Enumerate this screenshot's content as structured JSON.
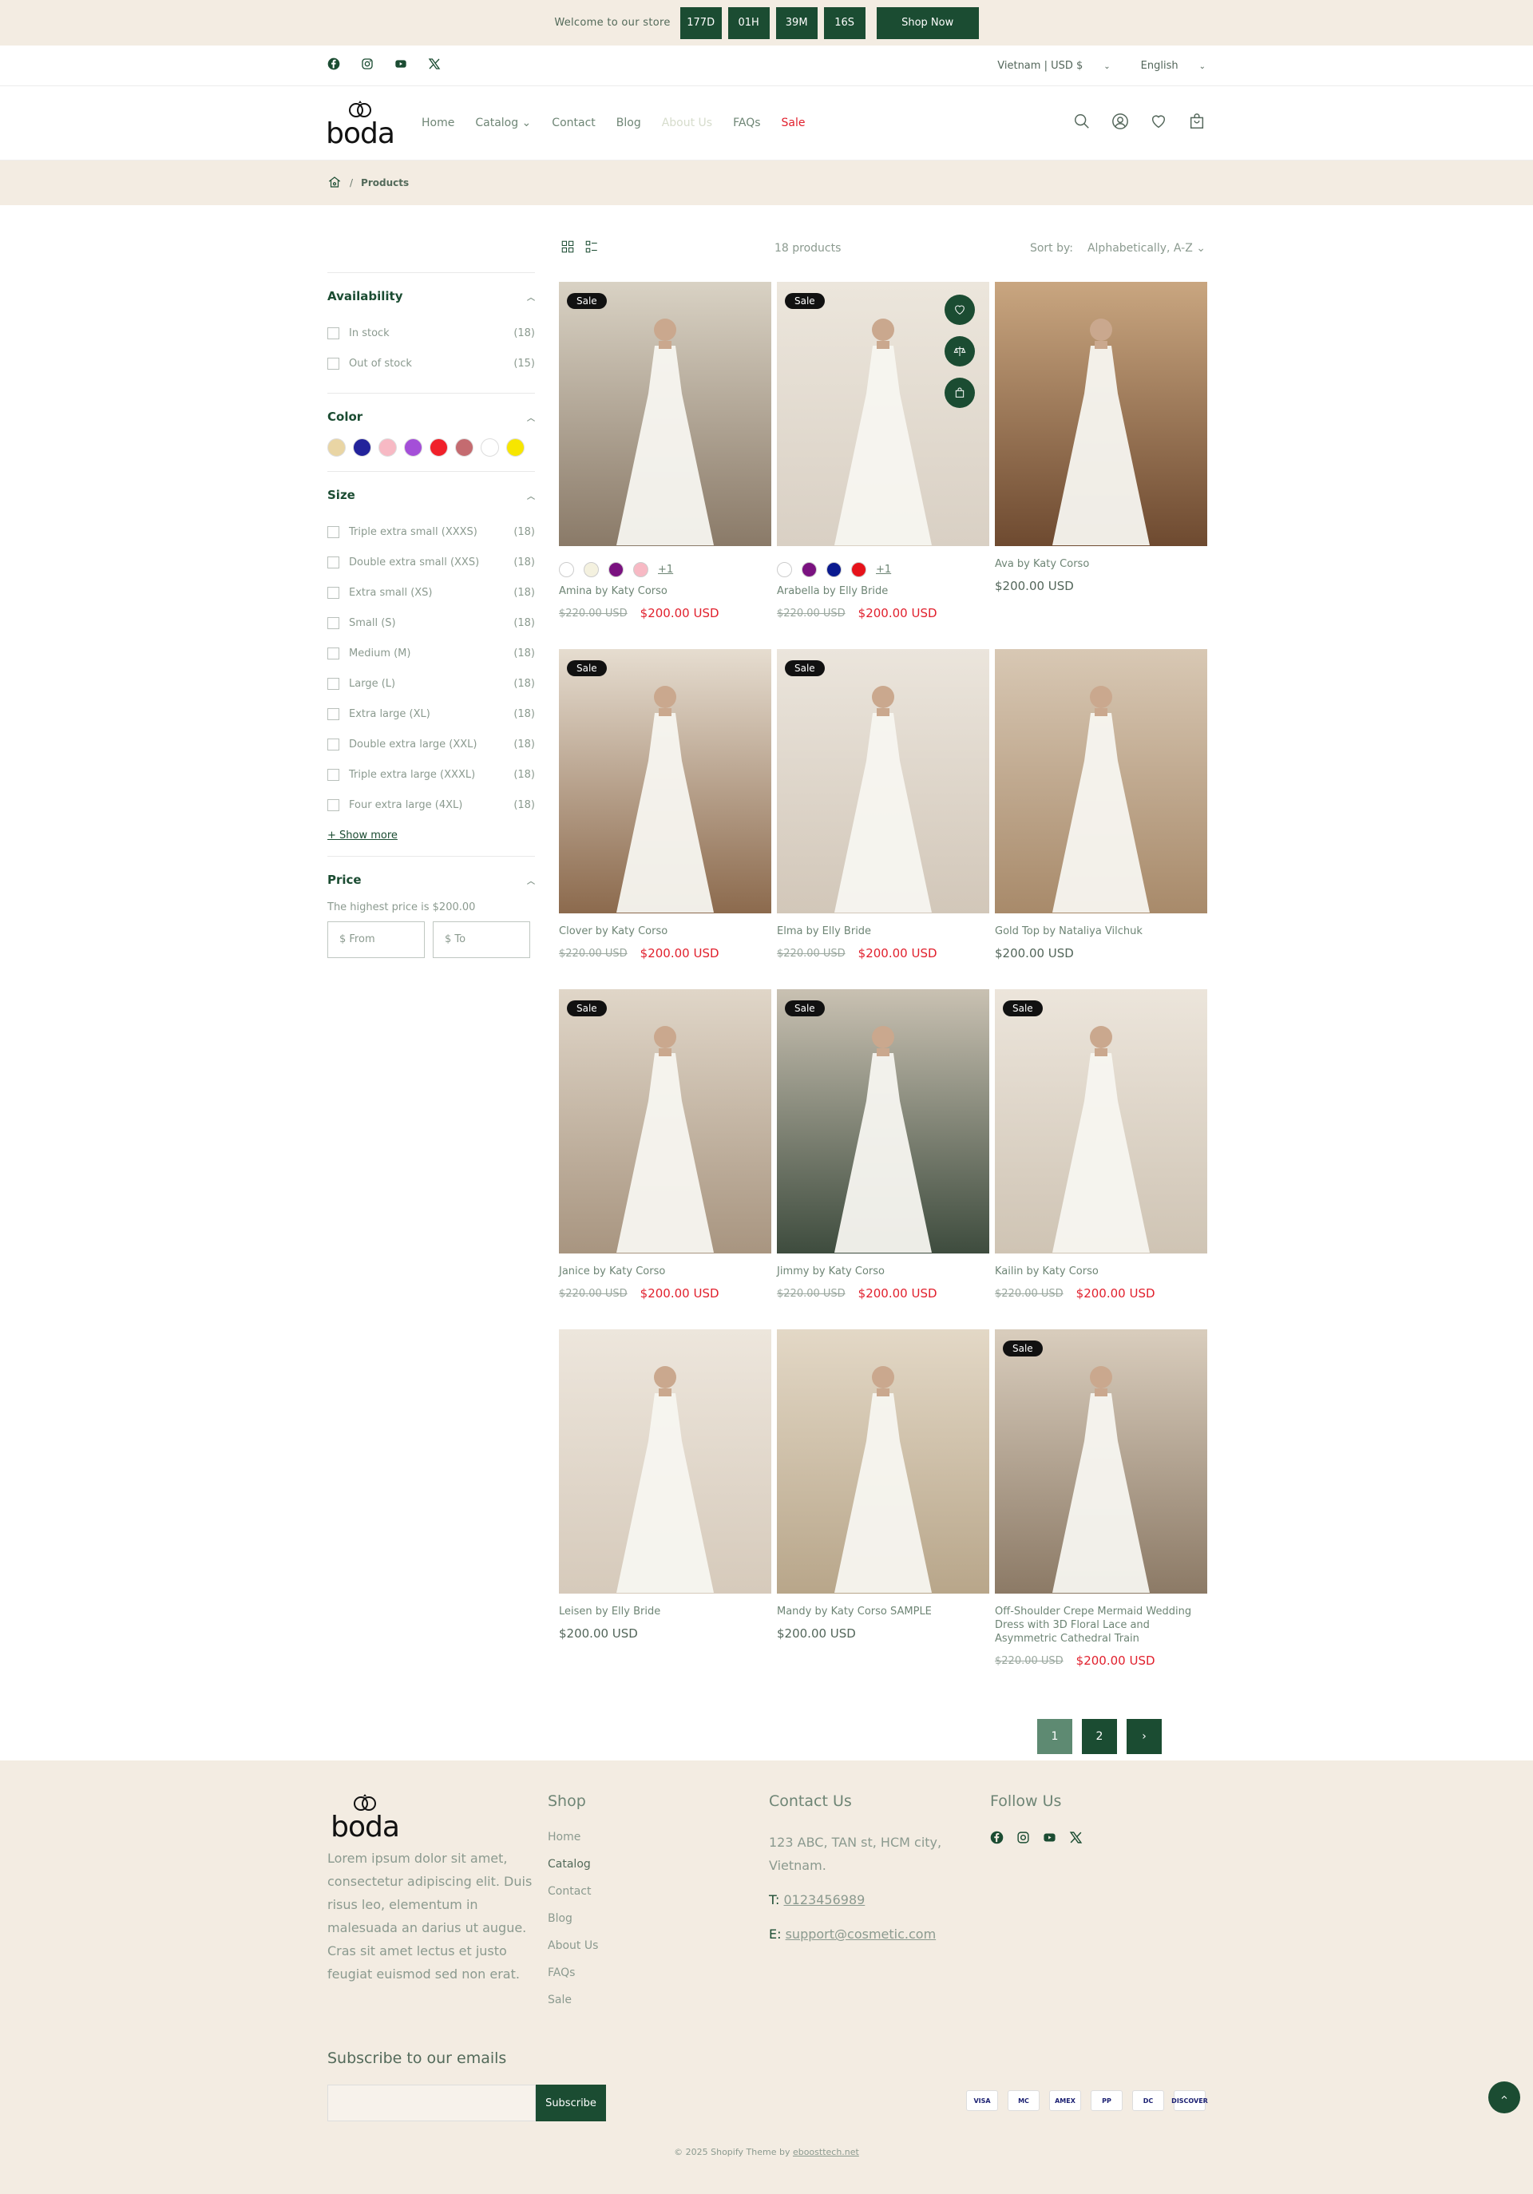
{
  "announcement": {
    "message": "Welcome to our store",
    "countdown": [
      "177D",
      "01H",
      "39M",
      "16S"
    ],
    "cta": "Shop Now"
  },
  "utility": {
    "region": "Vietnam | USD $",
    "language": "English"
  },
  "header": {
    "logo_text": "boda",
    "nav": [
      {
        "label": "Home"
      },
      {
        "label": "Catalog ⌄"
      },
      {
        "label": "Contact"
      },
      {
        "label": "Blog"
      },
      {
        "label": "About Us"
      },
      {
        "label": "FAQs"
      },
      {
        "label": "Sale"
      }
    ]
  },
  "breadcrumb": {
    "separator": "/",
    "current": "Products"
  },
  "filters": {
    "availability": {
      "title": "Availability",
      "items": [
        {
          "label": "In stock",
          "count": "(18)"
        },
        {
          "label": "Out of stock",
          "count": "(15)"
        }
      ]
    },
    "color": {
      "title": "Color",
      "swatches": [
        "#e9d5a4",
        "#23239b",
        "#f7b9c4",
        "#a44fd8",
        "#f0202a",
        "#c46b70",
        "#ffffff",
        "#f7e600"
      ]
    },
    "size": {
      "title": "Size",
      "items": [
        {
          "label": "Triple extra small (XXXS)",
          "count": "(18)"
        },
        {
          "label": "Double extra small (XXS)",
          "count": "(18)"
        },
        {
          "label": "Extra small (XS)",
          "count": "(18)"
        },
        {
          "label": "Small (S)",
          "count": "(18)"
        },
        {
          "label": "Medium (M)",
          "count": "(18)"
        },
        {
          "label": "Large (L)",
          "count": "(18)"
        },
        {
          "label": "Extra large (XL)",
          "count": "(18)"
        },
        {
          "label": "Double extra large (XXL)",
          "count": "(18)"
        },
        {
          "label": "Triple extra large (XXXL)",
          "count": "(18)"
        },
        {
          "label": "Four extra large (4XL)",
          "count": "(18)"
        }
      ],
      "show_more": "+ Show more"
    },
    "price": {
      "title": "Price",
      "note": "The highest price is $200.00",
      "from_placeholder": "$ From",
      "to_placeholder": "$ To"
    }
  },
  "toolbar": {
    "count": "18 products",
    "sort_label": "Sort by:",
    "sort_value": "Alphabetically, A-Z ⌄"
  },
  "products": [
    {
      "title": "Amina by Katy Corso",
      "sale": "Sale",
      "old": "$220.00 USD",
      "price": "$200.00 USD",
      "colors": [
        "#ffffff",
        "#f4f1df",
        "#7a1280",
        "#f7b9c4"
      ],
      "more": "+1",
      "bg": [
        "#8a7a68",
        "#d9d2c4"
      ]
    },
    {
      "title": "Arabella by Elly Bride",
      "sale": "Sale",
      "old": "$220.00 USD",
      "price": "$200.00 USD",
      "colors": [
        "#ffffff",
        "#7a1280",
        "#0a1a8f",
        "#e6121a"
      ],
      "more": "+1",
      "bg": [
        "#d9d0c4",
        "#ece6dc"
      ]
    },
    {
      "title": "Ava by Katy Corso",
      "sale": "",
      "old": "",
      "price": "$200.00 USD",
      "colors": [],
      "more": "",
      "bg": [
        "#6e4a30",
        "#c9a680"
      ]
    },
    {
      "title": "Clover by Katy Corso",
      "sale": "Sale",
      "old": "$220.00 USD",
      "price": "$200.00 USD",
      "colors": [],
      "more": "",
      "bg": [
        "#8c6a4d",
        "#e6ddd0"
      ]
    },
    {
      "title": "Elma by Elly Bride",
      "sale": "Sale",
      "old": "$220.00 USD",
      "price": "$200.00 USD",
      "colors": [],
      "more": "",
      "bg": [
        "#d2c7b9",
        "#ebe5dc"
      ]
    },
    {
      "title": "Gold Top by Nataliya Vilchuk",
      "sale": "",
      "old": "",
      "price": "$200.00 USD",
      "colors": [],
      "more": "",
      "bg": [
        "#a88a6a",
        "#d8c8b4"
      ]
    },
    {
      "title": "Janice by Katy Corso",
      "sale": "Sale",
      "old": "$220.00 USD",
      "price": "$200.00 USD",
      "colors": [],
      "more": "",
      "bg": [
        "#a89580",
        "#e0d6c8"
      ]
    },
    {
      "title": "Jimmy by Katy Corso",
      "sale": "Sale",
      "old": "$220.00 USD",
      "price": "$200.00 USD",
      "colors": [],
      "more": "",
      "bg": [
        "#3e4c3e",
        "#c9c1b2"
      ]
    },
    {
      "title": "Kailin by Katy Corso",
      "sale": "Sale",
      "old": "$220.00 USD",
      "price": "$200.00 USD",
      "colors": [],
      "more": "",
      "bg": [
        "#cfc4b4",
        "#ece5db"
      ]
    },
    {
      "title": "Leisen by Elly Bride",
      "sale": "",
      "old": "",
      "price": "$200.00 USD",
      "colors": [],
      "more": "",
      "bg": [
        "#d6cabb",
        "#ede6dc"
      ]
    },
    {
      "title": "Mandy by Katy Corso SAMPLE",
      "sale": "",
      "old": "",
      "price": "$200.00 USD",
      "colors": [],
      "more": "",
      "bg": [
        "#b8a68a",
        "#e3d8c6"
      ]
    },
    {
      "title": "Off-Shoulder Crepe Mermaid Wedding Dress with 3D Floral Lace and Asymmetric Cathedral Train",
      "sale": "Sale",
      "old": "$220.00 USD",
      "price": "$200.00 USD",
      "colors": [],
      "more": "",
      "bg": [
        "#8c7a66",
        "#d9cdbd"
      ]
    }
  ],
  "pagination": {
    "pages": [
      "1",
      "2"
    ],
    "next": "›"
  },
  "footer": {
    "about": "Lorem ipsum dolor sit amet, consectetur adipiscing elit. Duis risus leo, elementum in malesuada an darius ut augue. Cras sit amet lectus et justo feugiat euismod sed non erat.",
    "shop_title": "Shop",
    "shop_links": [
      "Home",
      "Catalog",
      "Contact",
      "Blog",
      "About Us",
      "FAQs",
      "Sale"
    ],
    "contact_title": "Contact Us",
    "address": "123 ABC, TAN st, HCM city, Vietnam.",
    "phone_label": "T:",
    "phone": "0123456989",
    "email_label": "E:",
    "email": "support@cosmetic.com",
    "follow_title": "Follow Us",
    "subscribe_title": "Subscribe to our emails",
    "subscribe_button": "Subscribe",
    "payments": [
      "VISA",
      "MC",
      "AMEX",
      "PP",
      "DC",
      "DISCOVER"
    ],
    "copyright": "© 2025  Shopify Theme by",
    "copyright_link": "eboosttech.net"
  }
}
